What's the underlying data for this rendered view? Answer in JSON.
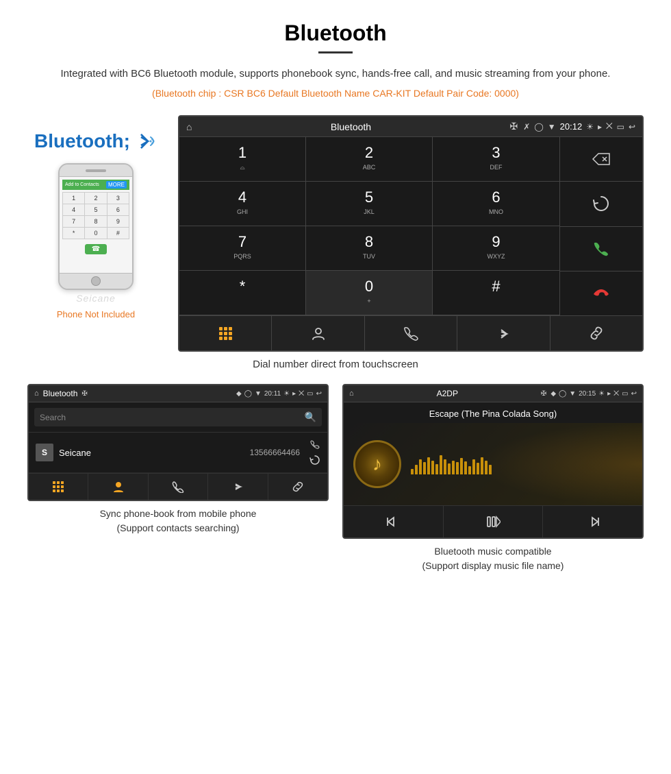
{
  "header": {
    "title": "Bluetooth",
    "description": "Integrated with BC6 Bluetooth module, supports phonebook sync, hands-free call, and music streaming from your phone.",
    "spec_line": "(Bluetooth chip : CSR BC6    Default Bluetooth Name CAR-KIT    Default Pair Code: 0000)"
  },
  "phone_aside": {
    "not_included": "Phone Not Included"
  },
  "car_dial_screen": {
    "status_bar": {
      "title": "Bluetooth",
      "time": "20:12"
    },
    "dial_keys": [
      {
        "num": "1",
        "letters": "⌓"
      },
      {
        "num": "2",
        "letters": "ABC"
      },
      {
        "num": "3",
        "letters": "DEF"
      },
      {
        "num": "4",
        "letters": "GHI"
      },
      {
        "num": "5",
        "letters": "JKL"
      },
      {
        "num": "6",
        "letters": "MNO"
      },
      {
        "num": "7",
        "letters": "PQRS"
      },
      {
        "num": "8",
        "letters": "TUV"
      },
      {
        "num": "9",
        "letters": "WXYZ"
      },
      {
        "num": "*",
        "letters": ""
      },
      {
        "num": "0",
        "letters": "+"
      },
      {
        "num": "#",
        "letters": ""
      }
    ],
    "action_bar_icons": [
      "grid",
      "person",
      "phone",
      "bluetooth",
      "link"
    ]
  },
  "main_caption": "Dial number direct from touchscreen",
  "phonebook_screen": {
    "status_bar": {
      "title": "Bluetooth",
      "time": "20:11"
    },
    "search_placeholder": "Search",
    "contacts": [
      {
        "initial": "S",
        "name": "Seicane",
        "phone": "13566664466"
      }
    ],
    "action_bar_icons": [
      "grid",
      "person-active",
      "phone",
      "bluetooth",
      "link"
    ]
  },
  "music_screen": {
    "status_bar": {
      "title": "A2DP",
      "time": "20:15"
    },
    "song_name": "Escape (The Pina Colada Song)",
    "eq_bars": [
      8,
      14,
      22,
      18,
      25,
      20,
      15,
      28,
      22,
      16,
      20,
      18,
      24,
      19,
      12,
      22,
      17,
      25,
      20,
      14
    ],
    "controls": [
      "prev",
      "play-pause",
      "next"
    ]
  },
  "bottom_captions": {
    "left": "Sync phone-book from mobile phone\n(Support contacts searching)",
    "right": "Bluetooth music compatible\n(Support display music file name)"
  },
  "watermark": "Seicane"
}
